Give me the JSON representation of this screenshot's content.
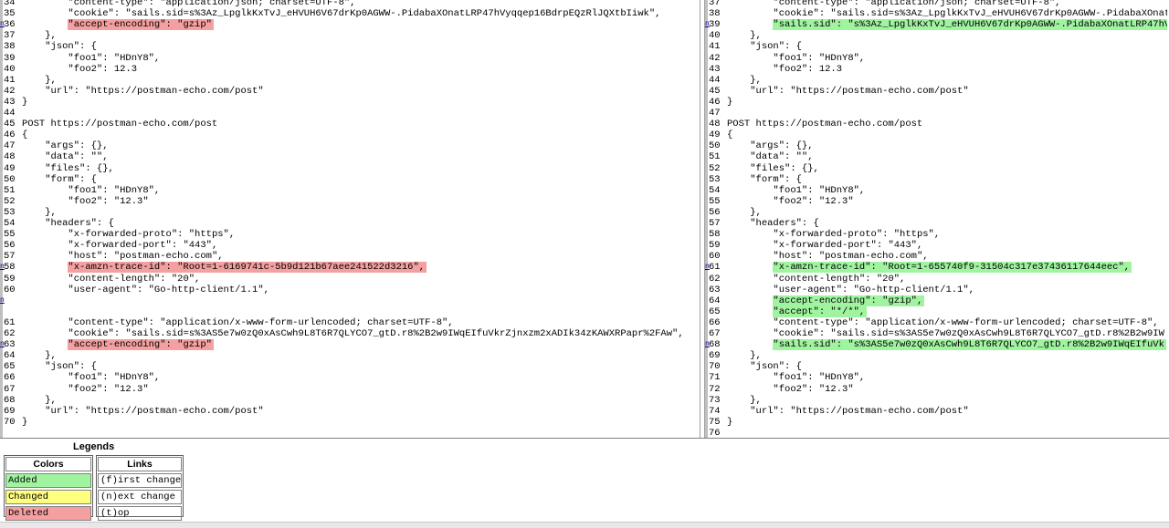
{
  "left_lines": [
    {
      "n": "34",
      "t": "        \"content-type\": \"application/json; charset=UTF-8\",",
      "k": ""
    },
    {
      "n": "35",
      "t": "        \"cookie\": \"sails.sid=s%3Az_LpglkKxTvJ_eHVUH6V67drKp0AGWW-.PidabaXOnatLRP47hVyqqep16BdrpEQzRlJQXtbIiwk\",",
      "k": ""
    },
    {
      "n": "36",
      "t": "        \"accept-encoding\": \"gzip\"",
      "k": "del",
      "l": "n"
    },
    {
      "n": "37",
      "t": "    },",
      "k": ""
    },
    {
      "n": "38",
      "t": "    \"json\": {",
      "k": ""
    },
    {
      "n": "39",
      "t": "        \"foo1\": \"HDnY8\",",
      "k": ""
    },
    {
      "n": "40",
      "t": "        \"foo2\": 12.3",
      "k": ""
    },
    {
      "n": "41",
      "t": "    },",
      "k": ""
    },
    {
      "n": "42",
      "t": "    \"url\": \"https://postman-echo.com/post\"",
      "k": ""
    },
    {
      "n": "43",
      "t": "}",
      "k": ""
    },
    {
      "n": "44",
      "t": "",
      "k": ""
    },
    {
      "n": "45",
      "t": "POST https://postman-echo.com/post",
      "k": ""
    },
    {
      "n": "46",
      "t": "{",
      "k": ""
    },
    {
      "n": "47",
      "t": "    \"args\": {},",
      "k": ""
    },
    {
      "n": "48",
      "t": "    \"data\": \"\",",
      "k": ""
    },
    {
      "n": "49",
      "t": "    \"files\": {},",
      "k": ""
    },
    {
      "n": "50",
      "t": "    \"form\": {",
      "k": ""
    },
    {
      "n": "51",
      "t": "        \"foo1\": \"HDnY8\",",
      "k": ""
    },
    {
      "n": "52",
      "t": "        \"foo2\": \"12.3\"",
      "k": ""
    },
    {
      "n": "53",
      "t": "    },",
      "k": ""
    },
    {
      "n": "54",
      "t": "    \"headers\": {",
      "k": ""
    },
    {
      "n": "55",
      "t": "        \"x-forwarded-proto\": \"https\",",
      "k": ""
    },
    {
      "n": "56",
      "t": "        \"x-forwarded-port\": \"443\",",
      "k": ""
    },
    {
      "n": "57",
      "t": "        \"host\": \"postman-echo.com\",",
      "k": ""
    },
    {
      "n": "58",
      "t": "        \"x-amzn-trace-id\": \"Root=1-6169741c-5b9d121b67aee241522d3216\",",
      "k": "del",
      "l": "n"
    },
    {
      "n": "59",
      "t": "        \"content-length\": \"20\",",
      "k": ""
    },
    {
      "n": "60",
      "t": "        \"user-agent\": \"Go-http-client/1.1\",",
      "k": ""
    },
    {
      "n": "",
      "t": "",
      "k": "",
      "l": "n"
    },
    {
      "n": "",
      "t": "",
      "k": ""
    },
    {
      "n": "61",
      "t": "        \"content-type\": \"application/x-www-form-urlencoded; charset=UTF-8\",",
      "k": ""
    },
    {
      "n": "62",
      "t": "        \"cookie\": \"sails.sid=s%3AS5e7w0zQ0xAsCwh9L8T6R7QLYCO7_gtD.r8%2B2w9IWqEIfuVkrZjnxzm2xADIk34zKAWXRPapr%2FAw\",",
      "k": ""
    },
    {
      "n": "63",
      "t": "        \"accept-encoding\": \"gzip\"",
      "k": "del",
      "l": "n"
    },
    {
      "n": "64",
      "t": "    },",
      "k": ""
    },
    {
      "n": "65",
      "t": "    \"json\": {",
      "k": ""
    },
    {
      "n": "66",
      "t": "        \"foo1\": \"HDnY8\",",
      "k": ""
    },
    {
      "n": "67",
      "t": "        \"foo2\": \"12.3\"",
      "k": ""
    },
    {
      "n": "68",
      "t": "    },",
      "k": ""
    },
    {
      "n": "69",
      "t": "    \"url\": \"https://postman-echo.com/post\"",
      "k": ""
    },
    {
      "n": "70",
      "t": "}",
      "k": ""
    }
  ],
  "right_lines": [
    {
      "n": "37",
      "t": "        \"content-type\": \"application/json; charset=UTF-8\",",
      "k": ""
    },
    {
      "n": "38",
      "t": "        \"cookie\": \"sails.sid=s%3Az_LpglkKxTvJ_eHVUH6V67drKp0AGWW-.PidabaXOnatLRP47h",
      "k": ""
    },
    {
      "n": "39",
      "t": "        \"sails.sid\": \"s%3Az_LpglkKxTvJ_eHVUH6V67drKp0AGWW-.PidabaXOnatLRP47hV",
      "k": "add",
      "l": "n"
    },
    {
      "n": "40",
      "t": "    },",
      "k": ""
    },
    {
      "n": "41",
      "t": "    \"json\": {",
      "k": ""
    },
    {
      "n": "42",
      "t": "        \"foo1\": \"HDnY8\",",
      "k": ""
    },
    {
      "n": "43",
      "t": "        \"foo2\": 12.3",
      "k": ""
    },
    {
      "n": "44",
      "t": "    },",
      "k": ""
    },
    {
      "n": "45",
      "t": "    \"url\": \"https://postman-echo.com/post\"",
      "k": ""
    },
    {
      "n": "46",
      "t": "}",
      "k": ""
    },
    {
      "n": "47",
      "t": "",
      "k": ""
    },
    {
      "n": "48",
      "t": "POST https://postman-echo.com/post",
      "k": ""
    },
    {
      "n": "49",
      "t": "{",
      "k": ""
    },
    {
      "n": "50",
      "t": "    \"args\": {},",
      "k": ""
    },
    {
      "n": "51",
      "t": "    \"data\": \"\",",
      "k": ""
    },
    {
      "n": "52",
      "t": "    \"files\": {},",
      "k": ""
    },
    {
      "n": "53",
      "t": "    \"form\": {",
      "k": ""
    },
    {
      "n": "54",
      "t": "        \"foo1\": \"HDnY8\",",
      "k": ""
    },
    {
      "n": "55",
      "t": "        \"foo2\": \"12.3\"",
      "k": ""
    },
    {
      "n": "56",
      "t": "    },",
      "k": ""
    },
    {
      "n": "57",
      "t": "    \"headers\": {",
      "k": ""
    },
    {
      "n": "58",
      "t": "        \"x-forwarded-proto\": \"https\",",
      "k": ""
    },
    {
      "n": "59",
      "t": "        \"x-forwarded-port\": \"443\",",
      "k": ""
    },
    {
      "n": "60",
      "t": "        \"host\": \"postman-echo.com\",",
      "k": ""
    },
    {
      "n": "61",
      "t": "        \"x-amzn-trace-id\": \"Root=1-655740f9-31504c317e37436117644eec\",",
      "k": "add",
      "l": "n"
    },
    {
      "n": "62",
      "t": "        \"content-length\": \"20\",",
      "k": ""
    },
    {
      "n": "63",
      "t": "        \"user-agent\": \"Go-http-client/1.1\",",
      "k": ""
    },
    {
      "n": "64",
      "t": "        \"accept-encoding\": \"gzip\",",
      "k": "add"
    },
    {
      "n": "65",
      "t": "        \"accept\": \"*/*\",",
      "k": "add"
    },
    {
      "n": "66",
      "t": "        \"content-type\": \"application/x-www-form-urlencoded; charset=UTF-8\",",
      "k": ""
    },
    {
      "n": "67",
      "t": "        \"cookie\": \"sails.sid=s%3AS5e7w0zQ0xAsCwh9L8T6R7QLYCO7_gtD.r8%2B2w9IW",
      "k": ""
    },
    {
      "n": "68",
      "t": "        \"sails.sid\": \"s%3AS5e7w0zQ0xAsCwh9L8T6R7QLYCO7_gtD.r8%2B2w9IWqEIfuVk",
      "k": "add",
      "l": "n"
    },
    {
      "n": "69",
      "t": "    },",
      "k": ""
    },
    {
      "n": "70",
      "t": "    \"json\": {",
      "k": ""
    },
    {
      "n": "71",
      "t": "        \"foo1\": \"HDnY8\",",
      "k": ""
    },
    {
      "n": "72",
      "t": "        \"foo2\": \"12.3\"",
      "k": ""
    },
    {
      "n": "73",
      "t": "    },",
      "k": ""
    },
    {
      "n": "74",
      "t": "    \"url\": \"https://postman-echo.com/post\"",
      "k": ""
    },
    {
      "n": "75",
      "t": "}",
      "k": ""
    },
    {
      "n": "76",
      "t": "",
      "k": ""
    }
  ],
  "legend": {
    "title": "Legends",
    "colors_header": "Colors",
    "added": "Added",
    "changed": "Changed",
    "deleted": "Deleted",
    "links_header": "Links",
    "first_change": "(f)irst change",
    "next_change": "(n)ext change",
    "top": "(t)op"
  },
  "colors": {
    "added": "#a0f4a0",
    "changed": "#ffff80",
    "deleted": "#f4a0a0"
  }
}
